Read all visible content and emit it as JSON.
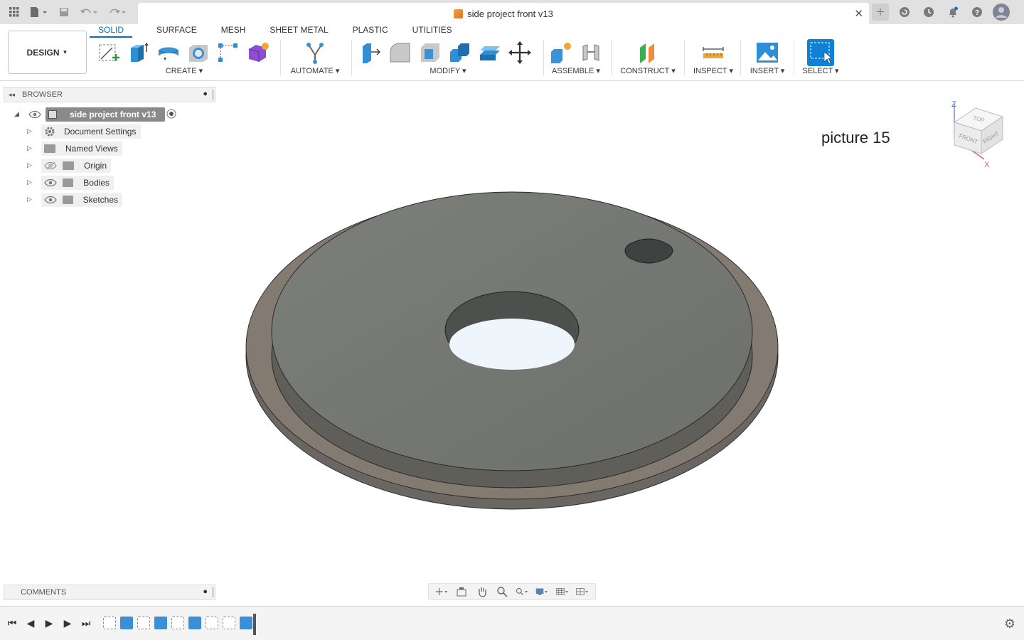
{
  "titlebar": {
    "document_title": "side project front v13",
    "icons": [
      "grid-icon",
      "file-icon",
      "save-icon",
      "undo-icon",
      "redo-icon",
      "close-icon",
      "plus-icon",
      "refresh-icon",
      "clock-icon",
      "bell-icon",
      "help-icon",
      "avatar"
    ]
  },
  "toolbar": {
    "workspace_button": "DESIGN",
    "tabs": [
      {
        "label": "SOLID",
        "active": true
      },
      {
        "label": "SURFACE",
        "active": false
      },
      {
        "label": "MESH",
        "active": false
      },
      {
        "label": "SHEET METAL",
        "active": false
      },
      {
        "label": "PLASTIC",
        "active": false
      },
      {
        "label": "UTILITIES",
        "active": false
      }
    ],
    "groups": {
      "create": "CREATE",
      "automate": "AUTOMATE",
      "modify": "MODIFY",
      "assemble": "ASSEMBLE",
      "construct": "CONSTRUCT",
      "inspect": "INSPECT",
      "insert": "INSERT",
      "select": "SELECT"
    },
    "accent_color": "#0a6fb8"
  },
  "browser": {
    "title": "BROWSER",
    "root": "side project front v13",
    "items": [
      {
        "label": "Document Settings"
      },
      {
        "label": "Named Views"
      },
      {
        "label": "Origin"
      },
      {
        "label": "Bodies"
      },
      {
        "label": "Sketches"
      }
    ]
  },
  "viewport": {
    "annotation": "picture 15",
    "viewcube": {
      "top": "TOP",
      "front": "FRONT",
      "right": "RIGHT",
      "axis_z": "Z",
      "axis_x": "X"
    }
  },
  "comments": {
    "title": "COMMENTS"
  },
  "timeline": {
    "feature_count": 9
  }
}
